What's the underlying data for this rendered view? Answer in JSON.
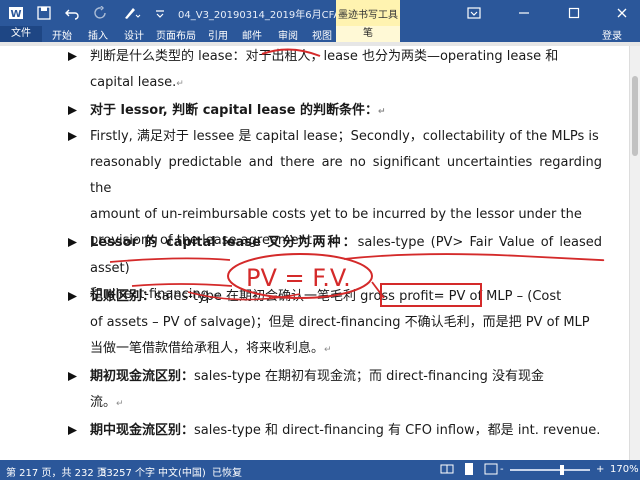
{
  "titlebar": {
    "doc_title": "04_V3_20190314_2019年6月CFA一级百题预...",
    "context_group": "墨迹书写工具",
    "qa_icons": [
      "word-icon",
      "save-icon",
      "undo-icon",
      "redo-icon",
      "ink-pen-icon",
      "customize-icon"
    ],
    "win_icons": [
      "ribbon-display-icon",
      "minimize-icon",
      "maximize-icon",
      "close-icon"
    ]
  },
  "ribbon": {
    "tabs": [
      "文件",
      "开始",
      "插入",
      "设计",
      "页面布局",
      "引用",
      "邮件",
      "审阅",
      "视图",
      "笔"
    ],
    "login": "登录"
  },
  "document": {
    "paragraphs": [
      {
        "lines": [
          "判断是什么类型的 lease：对于出租人，lease 也分为两类—operating lease 和",
          "capital lease."
        ],
        "bold": false
      },
      {
        "lines": [
          "对于 lessor, 判断 capital lease 的判断条件："
        ],
        "bold": true
      },
      {
        "lines": [
          "Firstly, 满足对于 lessee 是 capital lease；Secondly，collectability of the MLPs is",
          "reasonably predictable and there are no significant uncertainties regarding the",
          "amount of un-reimbursable costs yet to be incurred by the lessor under the",
          "provisions of the lease agreement."
        ],
        "bold": false
      },
      {
        "lead": "Lessor 的 capital lease 又分为两种：",
        "lines": [
          "sales-type (PV> Fair Value of leased asset)",
          "和 direct-financing."
        ],
        "bold": false
      },
      {
        "lead": "记账区别：",
        "lines": [
          "sales-type 在期初会确认一笔毛利 gross profit= PV of MLP – (Cost",
          "of assets – PV of salvage)；但是 direct-financing 不确认毛利，而是把 PV of MLP",
          "当做一笔借款借给承租人，将来收利息。"
        ],
        "bold": false
      },
      {
        "lead": "期初现金流区别：",
        "lines": [
          "sales-type 在期初有现金流；而 direct-financing 没有现金",
          "流。"
        ],
        "bold": false
      },
      {
        "lead": "期中现金流区别：",
        "lines": [
          "sales-type 和 direct-financing 有 CFO inflow，都是 int. revenue."
        ],
        "bold": false
      }
    ],
    "handwriting": "PV = F.V."
  },
  "statusbar": {
    "page": "第 217 页，共 232 页",
    "words": "33257 个字",
    "language": "中文(中国)",
    "recovered": "已恢复",
    "zoom": "170%",
    "zoom_out": "-",
    "zoom_in": "+"
  },
  "colors": {
    "accent": "#2b579a",
    "ink_red": "#d42a2a",
    "context_tab": "#fff3b0"
  }
}
